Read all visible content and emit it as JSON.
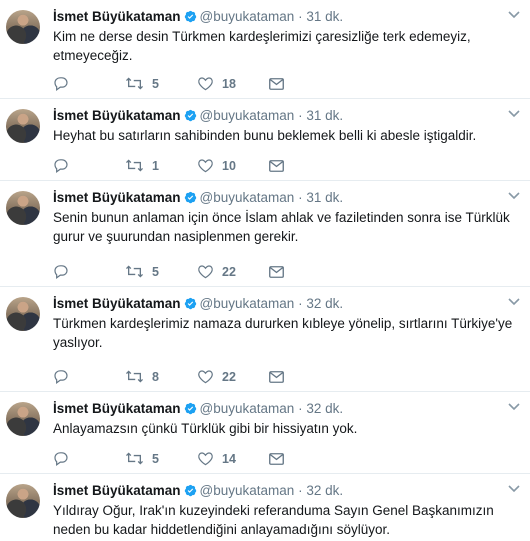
{
  "author": {
    "name": "İsmet Büyükataman",
    "handle": "@buyukataman"
  },
  "separator": "·",
  "tweets": [
    {
      "time": "31 dk.",
      "text": "Kim ne derse desin Türkmen kardeşlerimizi çaresizliğe terk edemeyiz, etmeyeceğiz.",
      "retweets": "5",
      "likes": "18"
    },
    {
      "time": "31 dk.",
      "text": "Heyhat bu satırların sahibinden bunu beklemek belli ki abesle iştigaldir.",
      "retweets": "1",
      "likes": "10"
    },
    {
      "time": "31 dk.",
      "text": "Senin bunun anlaman için önce İslam ahlak ve faziletinden sonra ise Türklük gurur ve şuurundan nasiplenmen gerekir.",
      "retweets": "5",
      "likes": "22"
    },
    {
      "time": "32 dk.",
      "text": "Türkmen kardeşlerimiz namaza dururken kıbleye yönelip, sırtlarını Türkiye'ye yaslıyor.",
      "retweets": "8",
      "likes": "22"
    },
    {
      "time": "32 dk.",
      "text": "Anlayamazsın çünkü Türklük gibi bir hissiyatın yok.",
      "retweets": "5",
      "likes": "14"
    },
    {
      "time": "32 dk.",
      "text": "Yıldıray Oğur, Irak'ın kuzeyindeki referanduma Sayın Genel Başkanımızın neden bu kadar hiddetlendiğini anlayamadığını söylüyor.",
      "retweets": "",
      "likes": ""
    }
  ],
  "icons": {
    "verified": "verified-badge-icon",
    "reply": "reply-icon",
    "retweet": "retweet-icon",
    "like": "heart-icon",
    "dm": "envelope-icon",
    "caret": "chevron-down-icon"
  },
  "colors": {
    "verified": "#1da1f2",
    "secondary_text": "#657786",
    "divider": "#e6ecf0"
  }
}
